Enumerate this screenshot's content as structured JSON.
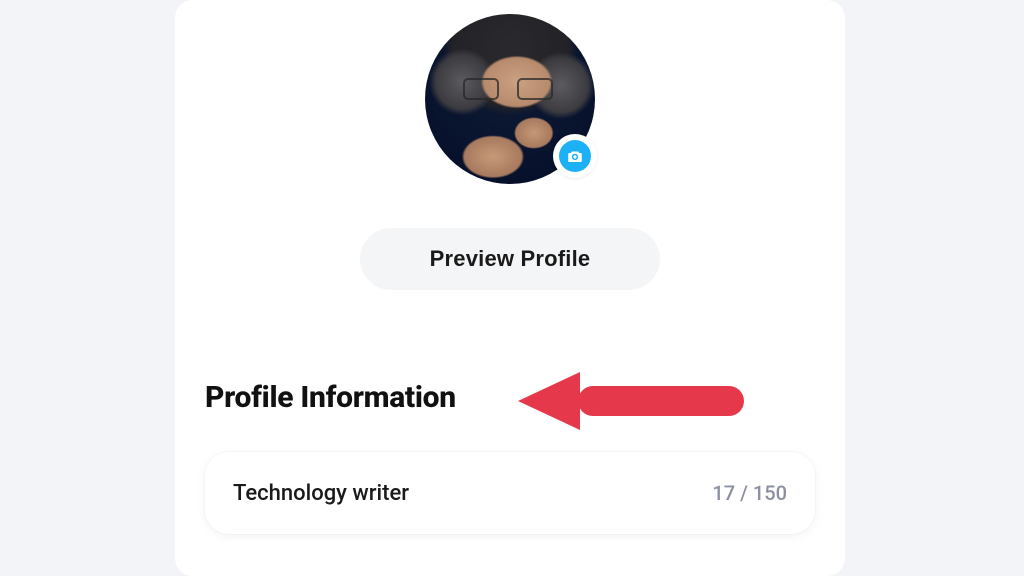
{
  "avatar": {
    "change_photo_icon": "camera-plus-icon"
  },
  "preview_button": {
    "label": "Preview Profile"
  },
  "section": {
    "heading": "Profile Information"
  },
  "bio": {
    "value": "Technology writer",
    "counter": "17 / 150"
  },
  "annotation": {
    "type": "arrow",
    "color": "#e6384b"
  }
}
